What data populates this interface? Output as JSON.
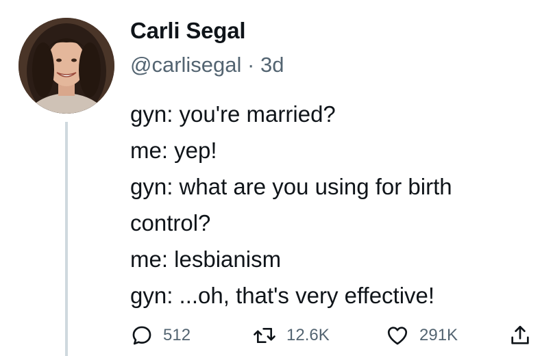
{
  "tweet": {
    "display_name": "Carli Segal",
    "handle": "@carlisegal",
    "separator": "·",
    "time": "3d",
    "lines": [
      "gyn: you're married?",
      "me: yep!",
      "gyn: what are you using for birth",
      "control?",
      "me: lesbianism",
      "gyn: ...oh, that's very effective!"
    ],
    "actions": {
      "reply_count": "512",
      "retweet_count": "12.6K",
      "like_count": "291K"
    }
  },
  "icons": {
    "reply": "reply-icon",
    "retweet": "retweet-icon",
    "like": "heart-icon",
    "share": "share-icon"
  },
  "colors": {
    "text": "#0f1419",
    "secondary": "#536471",
    "thread_line": "#cfd9de"
  }
}
